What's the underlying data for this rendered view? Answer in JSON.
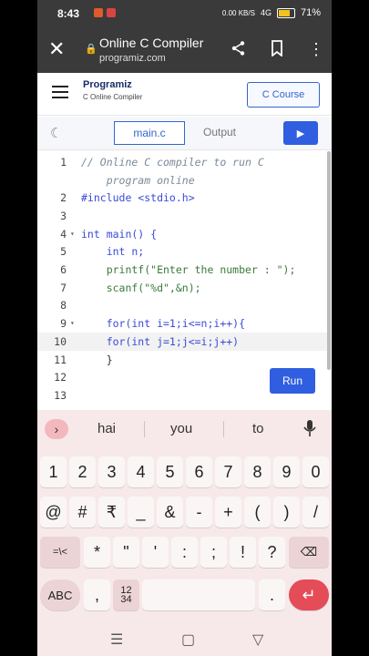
{
  "status": {
    "time": "8:43",
    "network": "0.00 KB/S",
    "signal": "4G",
    "battery": "71%"
  },
  "browser": {
    "close": "✕",
    "title": "Online C Compiler",
    "url": "programiz.com",
    "share": "share",
    "bookmark": "bookmark",
    "menu": "⋮"
  },
  "site": {
    "logo": "Programiz",
    "logo_sub": "C Online Compiler",
    "course_button": "C Course"
  },
  "tabs": {
    "active": "main.c",
    "inactive": "Output",
    "run_icon": "▶"
  },
  "editor": {
    "lines": [
      {
        "n": "1",
        "text": "// Online C compiler to run C"
      },
      {
        "n": "",
        "text": "    program online"
      },
      {
        "n": "2",
        "text": "#include <stdio.h>"
      },
      {
        "n": "3",
        "text": ""
      },
      {
        "n": "4",
        "text": "int main() {"
      },
      {
        "n": "5",
        "text": "    int n;"
      },
      {
        "n": "6",
        "text": "    printf(\"Enter the number : \");"
      },
      {
        "n": "7",
        "text": "    scanf(\"%d\",&n);"
      },
      {
        "n": "8",
        "text": ""
      },
      {
        "n": "9",
        "text": "    for(int i=1;i<=n;i++){"
      },
      {
        "n": "10",
        "text": "    for(int j=1;j<=i;j++)"
      },
      {
        "n": "11",
        "text": "    }"
      },
      {
        "n": "12",
        "text": ""
      },
      {
        "n": "13",
        "text": ""
      }
    ],
    "run_label": "Run"
  },
  "keyboard": {
    "suggestions": [
      "hai",
      "you",
      "to"
    ],
    "row1": [
      "1",
      "2",
      "3",
      "4",
      "5",
      "6",
      "7",
      "8",
      "9",
      "0"
    ],
    "row2": [
      "@",
      "#",
      "₹",
      "_",
      "&",
      "-",
      "+",
      "(",
      ")",
      "/"
    ],
    "row3": [
      "=\\<",
      "*",
      "\"",
      "'",
      ":",
      ";",
      "!",
      "?",
      "⌫"
    ],
    "abc": "ABC",
    "comma": ",",
    "numpad": "12\n34",
    "period": ".",
    "enter": "↵"
  },
  "nav": {
    "recent": "☰",
    "home": "▢",
    "back": "▽"
  }
}
